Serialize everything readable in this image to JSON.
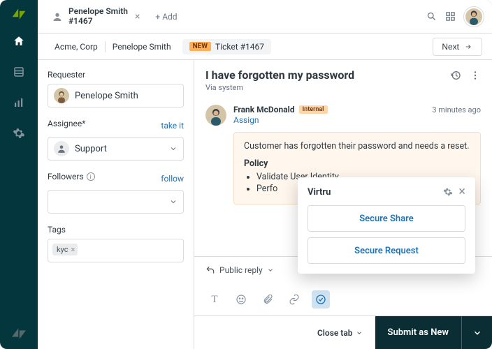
{
  "tab": {
    "line1": "Penelope Smith",
    "line2": "#1467",
    "add_label": "+ Add"
  },
  "breadcrumb": {
    "org": "Acme, Corp",
    "user": "Penelope Smith",
    "new_badge": "NEW",
    "ticket": "Ticket #1467",
    "next": "Next"
  },
  "sidebar": {
    "requester_label": "Requester",
    "requester_value": "Penelope Smith",
    "assignee_label": "Assignee*",
    "take_it": "take it",
    "assignee_value": "Support",
    "followers_label": "Followers",
    "follow": "follow",
    "tags_label": "Tags",
    "tags": [
      "kyc"
    ]
  },
  "conversation": {
    "title": "I have forgotten my password",
    "via": "Via system",
    "message": {
      "author": "Frank McDonald",
      "badge": "Internal",
      "time": "3 minutes ago",
      "assign": "Assign",
      "body": "Customer has forgotten their password and needs a reset.",
      "policy_label": "Policy",
      "bullets": [
        "Validate User Identity",
        "Perfo"
      ]
    },
    "reply_type": "Public reply"
  },
  "popover": {
    "title": "Virtru",
    "secure_share": "Secure Share",
    "secure_request": "Secure Request"
  },
  "footer": {
    "close": "Close tab",
    "submit": "Submit as New"
  }
}
